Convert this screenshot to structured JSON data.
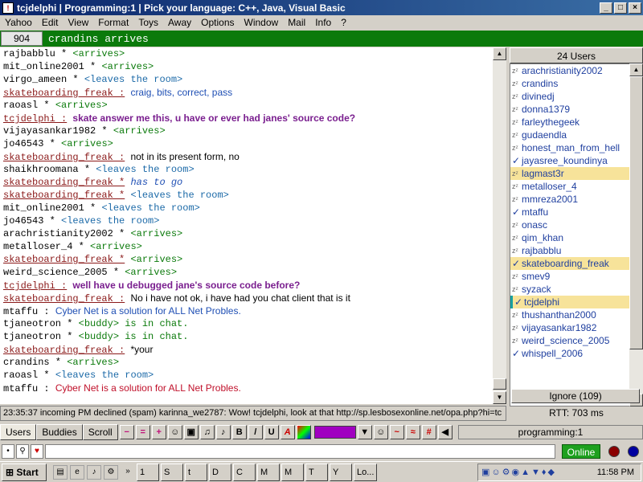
{
  "window": {
    "title": "tcjdelphi  |  Programming:1  |  Pick your language: C++, Java, Visual Basic",
    "buttons": [
      "_",
      "□",
      "×"
    ]
  },
  "menu": [
    "Yahoo",
    "Edit",
    "View",
    "Format",
    "Toys",
    "Away",
    "Options",
    "Window",
    "Mail",
    "Info",
    "?"
  ],
  "topic": {
    "count": "904",
    "message": "crandins arrives"
  },
  "chat": [
    {
      "nick": "rajbabblu",
      "nick_ul": false,
      "sep": " * ",
      "text": "<arrives>",
      "cls": "evt-arr"
    },
    {
      "nick": "mit_online2001",
      "nick_ul": false,
      "sep": " * ",
      "text": "<arrives>",
      "cls": "evt-arr"
    },
    {
      "nick": "virgo_ameen",
      "nick_ul": false,
      "sep": " * ",
      "text": "<leaves the room>",
      "cls": "evt-leave"
    },
    {
      "nick": "skateboarding freak :",
      "nick_ul": true,
      "sep": " ",
      "text": "craig, bits, correct, pass",
      "cls": "sans blue"
    },
    {
      "nick": "raoasl",
      "nick_ul": false,
      "sep": " * ",
      "text": "<arrives>",
      "cls": "evt-arr"
    },
    {
      "nick": "tcjdelphi :",
      "nick_ul": true,
      "sep": " ",
      "text": "skate answer me this, u have or ever had janes' source code?",
      "cls": "bold-purple"
    },
    {
      "nick": "vijayasankar1982",
      "nick_ul": false,
      "sep": " * ",
      "text": "<arrives>",
      "cls": "evt-arr"
    },
    {
      "nick": "jo46543",
      "nick_ul": false,
      "sep": " * ",
      "text": "<arrives>",
      "cls": "evt-arr"
    },
    {
      "nick": "skateboarding_freak :",
      "nick_ul": true,
      "sep": " ",
      "text": "not in its present form, no",
      "cls": "sans"
    },
    {
      "nick": "shaikhroomana",
      "nick_ul": false,
      "sep": " * ",
      "text": "<leaves the room>",
      "cls": "evt-leave"
    },
    {
      "nick": "skateboarding_freak *",
      "nick_ul": true,
      "sep": " ",
      "text": "has to go",
      "cls": "italic blue"
    },
    {
      "nick": "skateboarding_freak *",
      "nick_ul": true,
      "sep": " ",
      "text": "<leaves the room>",
      "cls": "evt-leave"
    },
    {
      "nick": "mit_online2001",
      "nick_ul": false,
      "sep": " * ",
      "text": "<leaves the room>",
      "cls": "evt-leave"
    },
    {
      "nick": "jo46543",
      "nick_ul": false,
      "sep": " * ",
      "text": "<leaves the room>",
      "cls": "evt-leave"
    },
    {
      "nick": "arachristianity2002",
      "nick_ul": false,
      "sep": " * ",
      "text": "<arrives>",
      "cls": "evt-arr"
    },
    {
      "nick": "metalloser_4",
      "nick_ul": false,
      "sep": " * ",
      "text": "<arrives>",
      "cls": "evt-arr"
    },
    {
      "nick": "skateboarding_freak *",
      "nick_ul": true,
      "sep": " ",
      "text": "<arrives>",
      "cls": "evt-arr"
    },
    {
      "nick": "weird_science_2005",
      "nick_ul": false,
      "sep": " * ",
      "text": "<arrives>",
      "cls": "evt-arr"
    },
    {
      "nick": "tcjdelphi :",
      "nick_ul": true,
      "sep": " ",
      "text": "well have u debugged jane's source code before?",
      "cls": "bold-purple"
    },
    {
      "nick": "skateboarding_freak :",
      "nick_ul": true,
      "sep": " ",
      "text": "No i have not ok, i have had you chat client that is it",
      "cls": "sans"
    },
    {
      "nick": "mtaffu :",
      "nick_ul": false,
      "sep": " ",
      "text": "Cyber Net is a solution for ALL Net Probles.",
      "cls": "sans blue"
    },
    {
      "nick": "tjaneotron",
      "nick_ul": false,
      "sep": " * ",
      "text": "<buddy> is in chat.",
      "cls": "buddy"
    },
    {
      "nick": "tjaneotron",
      "nick_ul": false,
      "sep": " * ",
      "text": "<buddy> is in chat.",
      "cls": "buddy"
    },
    {
      "nick": "skateboarding_freak :",
      "nick_ul": true,
      "sep": " ",
      "text": "*your",
      "cls": "sans"
    },
    {
      "nick": "crandins",
      "nick_ul": false,
      "sep": " * ",
      "text": "<arrives>",
      "cls": "evt-arr"
    },
    {
      "nick": "raoasl",
      "nick_ul": false,
      "sep": " * ",
      "text": "<leaves the room>",
      "cls": "evt-leave"
    },
    {
      "nick": "mtaffu :",
      "nick_ul": false,
      "sep": " ",
      "text": "Cyber Net is a solution for ALL Net Probles.",
      "cls": "red"
    }
  ],
  "users": {
    "header": "24 Users",
    "list": [
      {
        "name": "arachristianity2002",
        "icon": "z",
        "sel": false,
        "cur": false
      },
      {
        "name": "crandins",
        "icon": "z",
        "sel": false,
        "cur": false
      },
      {
        "name": "divinedj",
        "icon": "z",
        "sel": false,
        "cur": false
      },
      {
        "name": "donna1379",
        "icon": "z",
        "sel": false,
        "cur": false
      },
      {
        "name": "farleythegeek",
        "icon": "z",
        "sel": false,
        "cur": false
      },
      {
        "name": "gudaendla",
        "icon": "z",
        "sel": false,
        "cur": false
      },
      {
        "name": "honest_man_from_hell",
        "icon": "z",
        "sel": false,
        "cur": false
      },
      {
        "name": "jayasree_koundinya",
        "icon": "check",
        "sel": false,
        "cur": false
      },
      {
        "name": "lagmast3r",
        "icon": "z",
        "sel": true,
        "cur": false
      },
      {
        "name": "metalloser_4",
        "icon": "z",
        "sel": false,
        "cur": false
      },
      {
        "name": "mmreza2001",
        "icon": "z",
        "sel": false,
        "cur": false
      },
      {
        "name": "mtaffu",
        "icon": "check",
        "sel": false,
        "cur": false
      },
      {
        "name": "onasc",
        "icon": "z",
        "sel": false,
        "cur": false
      },
      {
        "name": "qim_khan",
        "icon": "z",
        "sel": false,
        "cur": false
      },
      {
        "name": "rajbabblu",
        "icon": "z",
        "sel": false,
        "cur": false
      },
      {
        "name": "skateboarding_freak",
        "icon": "check",
        "sel": true,
        "cur": false
      },
      {
        "name": "smev9",
        "icon": "z",
        "sel": false,
        "cur": false
      },
      {
        "name": "syzack",
        "icon": "z",
        "sel": false,
        "cur": false
      },
      {
        "name": "tcjdelphi",
        "icon": "check",
        "sel": true,
        "cur": true
      },
      {
        "name": "thushanthan2000",
        "icon": "z",
        "sel": false,
        "cur": false
      },
      {
        "name": "vijayasankar1982",
        "icon": "z",
        "sel": false,
        "cur": false
      },
      {
        "name": "weird_science_2005",
        "icon": "z",
        "sel": false,
        "cur": false
      },
      {
        "name": "whispell_2006",
        "icon": "check",
        "sel": false,
        "cur": false
      }
    ],
    "ignore": "Ignore (109)"
  },
  "status": {
    "text": "23:35:37 incoming PM declined (spam) karinna_we2787: Wow! tcjdelphi, look at that http://sp.lesbosexonline.net/opa.php?hi=tc",
    "rtt": "RTT: 703 ms"
  },
  "toolbar": {
    "tabs": [
      "Users",
      "Buddies",
      "Scroll"
    ],
    "room": "programming:1"
  },
  "input": {
    "value": "",
    "online": "Online"
  },
  "taskbar": {
    "start": "Start",
    "clock": "11:58 PM",
    "buttons": [
      "1",
      "S",
      "t",
      "D",
      "C",
      "M",
      "M",
      "T",
      "Y",
      "Lo..."
    ]
  },
  "colors": {
    "title_start": "#0a246a",
    "topic_bg": "#0b7a0b",
    "online": "#1ea01e"
  }
}
